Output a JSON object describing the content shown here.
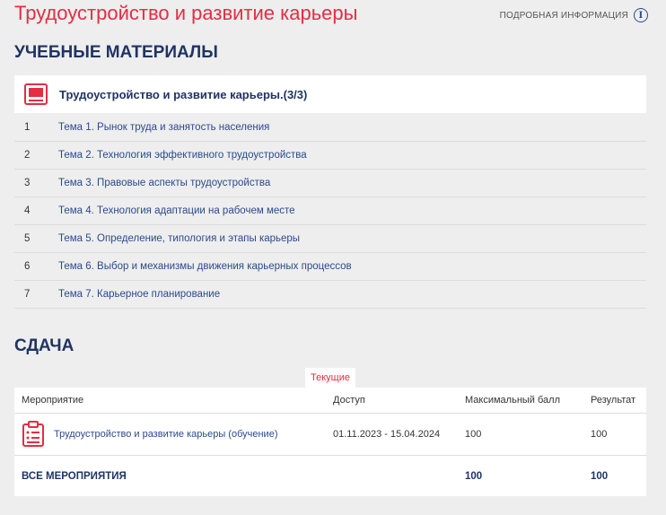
{
  "header": {
    "title": "Трудоустройство и развитие карьеры",
    "more_info": "ПОДРОБНАЯ ИНФОРМАЦИЯ",
    "info_icon_glyph": "i"
  },
  "materials": {
    "section_title": "УЧЕБНЫЕ МАТЕРИАЛЫ",
    "course_name": "Трудоустройство и развитие карьеры.(3/3)",
    "topics": [
      {
        "num": "1",
        "label": "Тема 1. Рынок труда и занятость населения"
      },
      {
        "num": "2",
        "label": "Тема 2. Технология эффективного трудоустройства"
      },
      {
        "num": "3",
        "label": "Тема 3. Правовые аспекты трудоустройства"
      },
      {
        "num": "4",
        "label": "Тема 4. Технология адаптации на рабочем месте"
      },
      {
        "num": "5",
        "label": "Тема 5. Определение, типология и этапы карьеры"
      },
      {
        "num": "6",
        "label": "Тема 6. Выбор и механизмы движения карьерных процессов"
      },
      {
        "num": "7",
        "label": "Тема 7. Карьерное планирование"
      }
    ]
  },
  "exam": {
    "section_title": "СДАЧА",
    "tab_current": "Текущие",
    "columns": {
      "event": "Мероприятие",
      "access": "Доступ",
      "max_score": "Максимальный балл",
      "result": "Результат"
    },
    "rows": [
      {
        "event": "Трудоустройство и развитие карьеры (обучение)",
        "access": "01.11.2023 - 15.04.2024",
        "max_score": "100",
        "result": "100"
      }
    ],
    "total": {
      "label": "ВСЕ МЕРОПРИЯТИЯ",
      "max_score": "100",
      "result": "100"
    }
  },
  "colors": {
    "accent": "#e42d42",
    "heading": "#1f3463",
    "link": "#2b4a8b",
    "background": "#eeeeee"
  },
  "icons": {
    "course": "book-icon",
    "exam": "clipboard-icon",
    "info": "info-icon"
  }
}
